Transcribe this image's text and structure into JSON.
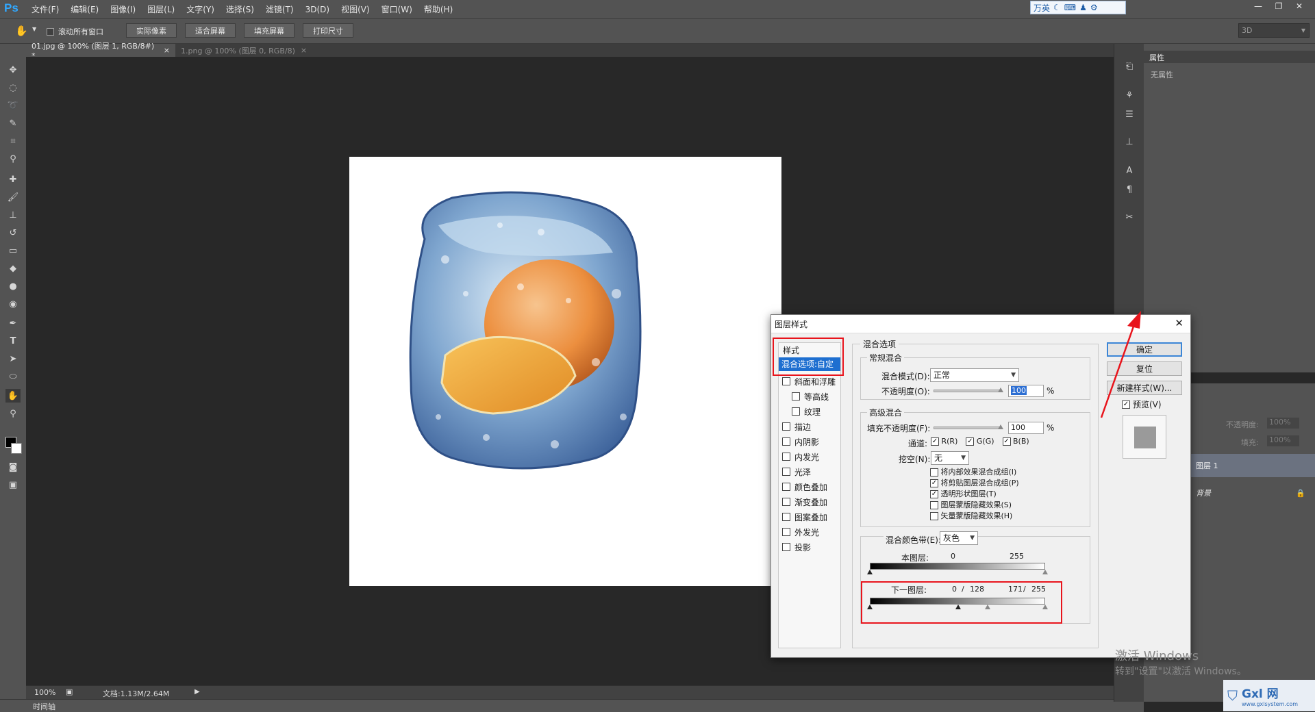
{
  "app": {
    "logo": "Ps"
  },
  "menu": [
    "文件(F)",
    "编辑(E)",
    "图像(I)",
    "图层(L)",
    "文字(Y)",
    "选择(S)",
    "滤镜(T)",
    "3D(D)",
    "视图(V)",
    "窗口(W)",
    "帮助(H)"
  ],
  "ime": {
    "chars": "万英",
    "icons": [
      "moon-icon",
      "keyboard-icon",
      "user-icon",
      "settings-icon"
    ]
  },
  "options": {
    "scroll_all_label": "滚动所有窗口",
    "buttons": [
      "实际像素",
      "适合屏幕",
      "填充屏幕",
      "打印尺寸"
    ],
    "workspace": "3D"
  },
  "tabs": [
    {
      "label": "01.jpg @ 100% (图层 1, RGB/8#) *",
      "active": true
    },
    {
      "label": "1.png @ 100% (图层 0, RGB/8)",
      "active": false
    }
  ],
  "status": {
    "zoom": "100%",
    "doc": "文档:1.13M/2.64M",
    "timeline": "时间轴"
  },
  "properties": {
    "tab": "属性",
    "empty": "无属性"
  },
  "layers": {
    "opacity_label": "不透明度:",
    "opacity_value": "100%",
    "fill_label": "填充:",
    "fill_value": "100%",
    "items": [
      {
        "name": "图层 1",
        "selected": true
      },
      {
        "name": "背景",
        "selected": false
      }
    ]
  },
  "dialog": {
    "title": "图层样式",
    "styles_header": "样式",
    "blend_options_item": "混合选项:自定",
    "style_items": [
      {
        "label": "斜面和浮雕",
        "checked": false,
        "indent": 0
      },
      {
        "label": "等高线",
        "checked": false,
        "indent": 1
      },
      {
        "label": "纹理",
        "checked": false,
        "indent": 1
      },
      {
        "label": "描边",
        "checked": false,
        "indent": 0
      },
      {
        "label": "内阴影",
        "checked": false,
        "indent": 0
      },
      {
        "label": "内发光",
        "checked": false,
        "indent": 0
      },
      {
        "label": "光泽",
        "checked": false,
        "indent": 0
      },
      {
        "label": "颜色叠加",
        "checked": false,
        "indent": 0
      },
      {
        "label": "渐变叠加",
        "checked": false,
        "indent": 0
      },
      {
        "label": "图案叠加",
        "checked": false,
        "indent": 0
      },
      {
        "label": "外发光",
        "checked": false,
        "indent": 0
      },
      {
        "label": "投影",
        "checked": false,
        "indent": 0
      }
    ],
    "blend_options_title": "混合选项",
    "general": {
      "title": "常规混合",
      "mode_label": "混合模式(D):",
      "mode_value": "正常",
      "opacity_label": "不透明度(O):",
      "opacity_value": "100",
      "percent": "%"
    },
    "advanced": {
      "title": "高级混合",
      "fill_label": "填充不透明度(F):",
      "fill_value": "100",
      "percent": "%",
      "channels_label": "通道:",
      "channels": [
        "R(R)",
        "G(G)",
        "B(B)"
      ],
      "knockout_label": "挖空(N):",
      "knockout_value": "无",
      "options": [
        {
          "label": "将内部效果混合成组(I)",
          "checked": false
        },
        {
          "label": "将剪贴图层混合成组(P)",
          "checked": true
        },
        {
          "label": "透明形状图层(T)",
          "checked": true
        },
        {
          "label": "图层蒙版隐藏效果(S)",
          "checked": false
        },
        {
          "label": "矢量蒙版隐藏效果(H)",
          "checked": false
        }
      ]
    },
    "blend_if": {
      "label": "混合颜色带(E):",
      "value": "灰色",
      "this_layer_label": "本图层:",
      "this_low": "0",
      "this_high": "255",
      "under_layer_label": "下一图层:",
      "under_low": "0",
      "under_low2": "128",
      "slash": "/",
      "under_high": "171",
      "under_high2": "255"
    },
    "buttons": {
      "ok": "确定",
      "reset": "复位",
      "new_style": "新建样式(W)...",
      "preview": "预览(V)"
    }
  },
  "watermark": {
    "line1": "激活 Windows",
    "line2": "转到\"设置\"以激活 Windows。"
  },
  "badge": {
    "text": "Gxl 网",
    "sub": "www.gxlsystem.com"
  }
}
